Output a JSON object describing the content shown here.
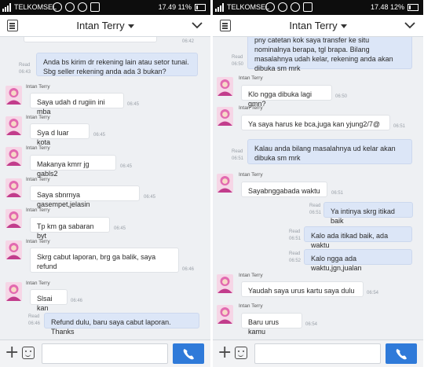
{
  "colors": {
    "accent": "#2f7ad9",
    "outgoing_bubble": "#dce6f7",
    "incoming_bubble": "#ffffff",
    "chat_bg": "#eef0f3"
  },
  "screens": [
    {
      "status": {
        "carrier": "TELKOMSEL",
        "time": "17.49 11%"
      },
      "header": {
        "title": "Intan Terry"
      },
      "messages": [
        {
          "dir": "in",
          "time": "06:42"
        },
        {
          "dir": "out",
          "text": "Anda bs kirim dr rekening lain atau setor tunai. Sbg seller rekening anda ada 3 bukan?",
          "read": "Read",
          "time": "06:43"
        },
        {
          "dir": "in",
          "sender": "Intan Terry",
          "text": "Saya udah d rugiin ini mba",
          "time": "06:45"
        },
        {
          "dir": "in",
          "sender": "Intan Terry",
          "text": "Sya d luar kota",
          "time": "06:45"
        },
        {
          "dir": "in",
          "sender": "Intan Terry",
          "text": "Makanya kmrr jg gabls2",
          "time": "06:45"
        },
        {
          "dir": "in",
          "sender": "Intan Terry",
          "text": "Saya sbnrnya gasempet,jelasin",
          "time": "06:45"
        },
        {
          "dir": "in",
          "sender": "Intan Terry",
          "text": "Tp km ga sabaran byt",
          "time": "06:45"
        },
        {
          "dir": "in",
          "sender": "Intan Terry",
          "text": "Skrg cabut laporan, brg ga balik, saya refund",
          "time": "06:46"
        },
        {
          "dir": "in",
          "sender": "Intan Terry",
          "text": "Slsai kan",
          "time": "06:46"
        },
        {
          "dir": "out",
          "text": "Refund dulu, baru saya cabut laporan. Thanks",
          "read": "Read",
          "time": "06:46"
        }
      ]
    },
    {
      "status": {
        "carrier": "TELKOMSEL",
        "time": "17.48 12%"
      },
      "header": {
        "title": "Intan Terry"
      },
      "messages": [
        {
          "dir": "out",
          "text": "pny catetan kok saya transfer ke situ nominalnya berapa, tgl brapa. Bilang masalahnya udah kelar, rekening anda akan dibuka sm mrk",
          "read": "Read",
          "time": "06:50"
        },
        {
          "dir": "in",
          "sender": "Intan Terry",
          "text": "Klo ngga dibuka lagi gmn?",
          "time": "06:50"
        },
        {
          "dir": "in",
          "sender": "Intan Terry",
          "text": "Ya saya harus ke bca,juga kan yjung2/7@",
          "time": "06:51"
        },
        {
          "dir": "out",
          "text": "Kalau anda bilang masalahnya ud kelar akan dibuka sm mrk",
          "read": "Read",
          "time": "06:51"
        },
        {
          "dir": "in",
          "sender": "Intan Terry",
          "text": "Sayabnggabada waktu",
          "time": "06:51"
        },
        {
          "dir": "out",
          "text": "Ya intinya skrg itikad baik",
          "read": "Read",
          "time": "06:51"
        },
        {
          "dir": "out",
          "text": "Kalo ada itikad baik, ada waktu",
          "read": "Read",
          "time": "06:51"
        },
        {
          "dir": "out",
          "text": "Kalo ngga ada waktu,jgn,jualan",
          "read": "Read",
          "time": "06:52"
        },
        {
          "dir": "in",
          "sender": "Intan Terry",
          "text": "Yaudah saya urus kartu saya dulu",
          "time": "06:54"
        },
        {
          "dir": "in",
          "sender": "Intan Terry",
          "text": "Baru urus kamu",
          "time": "06:54"
        }
      ]
    }
  ]
}
